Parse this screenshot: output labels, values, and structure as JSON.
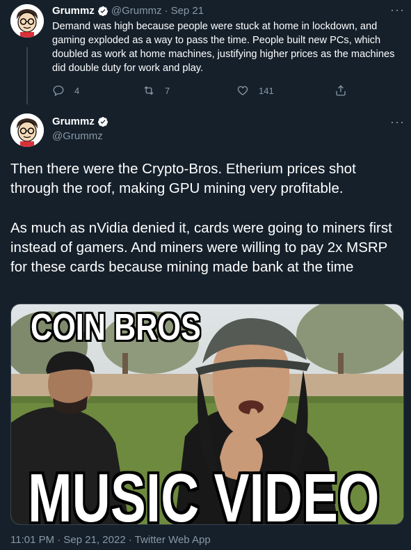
{
  "reply_tweet": {
    "name": "Grummz",
    "handle": "@Grummz",
    "separator": "·",
    "date": "Sep 21",
    "text": "Demand was high because people were stuck at home in lockdown, and gaming exploded as a way to pass the time. People built new PCs, which doubled as work at home machines, justifying higher prices as the machines did double duty for work and play.",
    "actions": {
      "replies": "4",
      "retweets": "7",
      "likes": "141"
    }
  },
  "main_tweet": {
    "name": "Grummz",
    "handle": "@Grummz",
    "paragraph_1": "Then there were the Crypto-Bros. Etherium prices shot through the roof, making GPU mining very profitable.",
    "paragraph_2": "As much as nVidia denied it, cards were going to miners first instead of gamers. And miners were willing to pay 2x MSRP for these cards because mining made bank at the time",
    "media": {
      "top_caption": "COIN BROS",
      "bottom_caption": "MUSIC VIDEO"
    },
    "timestamp": "11:01 PM · Sep 21, 2022 · Twitter Web App"
  },
  "icons": {
    "verified": "verified-badge-icon",
    "more": "more-icon",
    "reply": "reply-icon",
    "retweet": "retweet-icon",
    "like": "heart-icon",
    "share": "share-icon"
  },
  "colors": {
    "background": "#15202b",
    "secondary_text": "#8899a6",
    "divider": "#38444d",
    "verified": "#ffffff"
  }
}
